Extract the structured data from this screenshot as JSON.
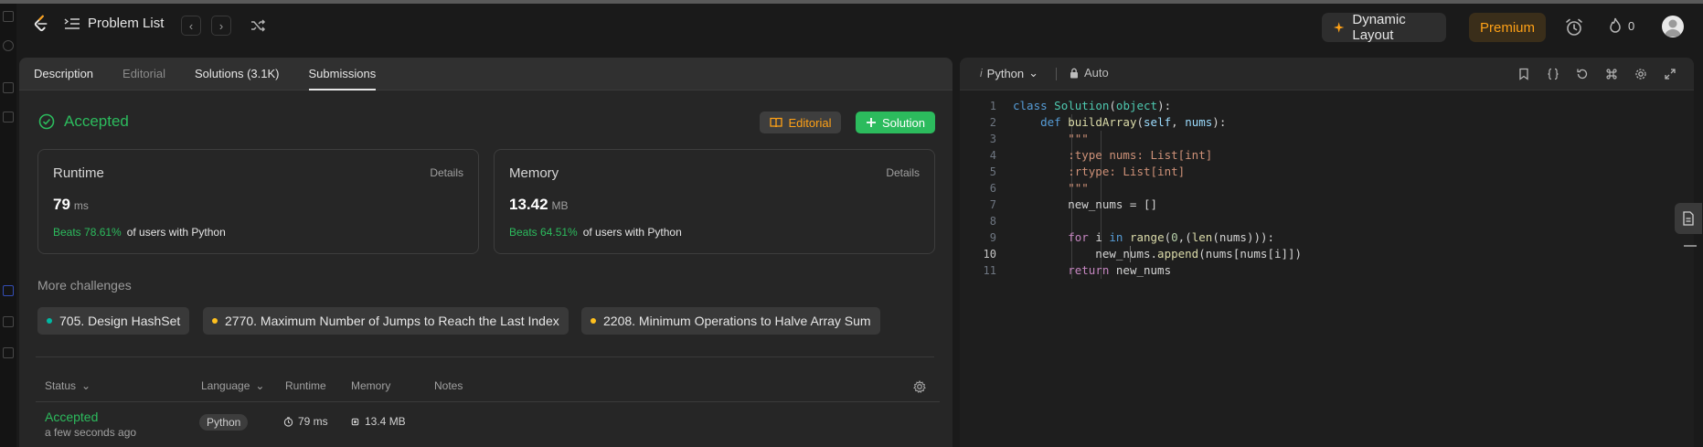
{
  "topbar": {
    "problem_list_label": "Problem List",
    "dynamic_layout_label": "Dynamic Layout",
    "premium_label": "Premium",
    "streak_count": "0"
  },
  "left": {
    "tabs": [
      {
        "label": "Description"
      },
      {
        "label": "Editorial"
      },
      {
        "label": "Solutions (3.1K)"
      },
      {
        "label": "Submissions"
      }
    ],
    "status_title": "Accepted",
    "editorial_button": "Editorial",
    "solution_button": "Solution",
    "runtime": {
      "title": "Runtime",
      "details": "Details",
      "value": "79",
      "unit": "ms",
      "beats": "Beats 78.61%",
      "suffix": "of users with Python"
    },
    "memory": {
      "title": "Memory",
      "details": "Details",
      "value": "13.42",
      "unit": "MB",
      "beats": "Beats 64.51%",
      "suffix": "of users with Python"
    },
    "more_challenges_label": "More challenges",
    "challenges": [
      {
        "label": "705. Design HashSet",
        "color": "#00b8a3"
      },
      {
        "label": "2770. Maximum Number of Jumps to Reach the Last Index",
        "color": "#ffc01e"
      },
      {
        "label": "2208. Minimum Operations to Halve Array Sum",
        "color": "#ffc01e"
      }
    ],
    "table": {
      "headers": {
        "status": "Status",
        "language": "Language",
        "runtime": "Runtime",
        "memory": "Memory",
        "notes": "Notes"
      },
      "row": {
        "status": "Accepted",
        "time_ago": "a few seconds ago",
        "language": "Python",
        "runtime": "79 ms",
        "memory": "13.4 MB"
      }
    }
  },
  "editor": {
    "language": "Python",
    "mode": "Auto",
    "current_line": 10,
    "lines": [
      "class Solution(object):",
      "    def buildArray(self, nums):",
      "        \"\"\"",
      "        :type nums: List[int]",
      "        :rtype: List[int]",
      "        \"\"\"",
      "        new_nums = []",
      "",
      "        for i in range(0,(len(nums))):",
      "            new_nums.append(nums[nums[i]])",
      "        return new_nums"
    ]
  },
  "colors": {
    "accent_green": "#2cbb5d",
    "accent_orange": "#ffa116"
  }
}
